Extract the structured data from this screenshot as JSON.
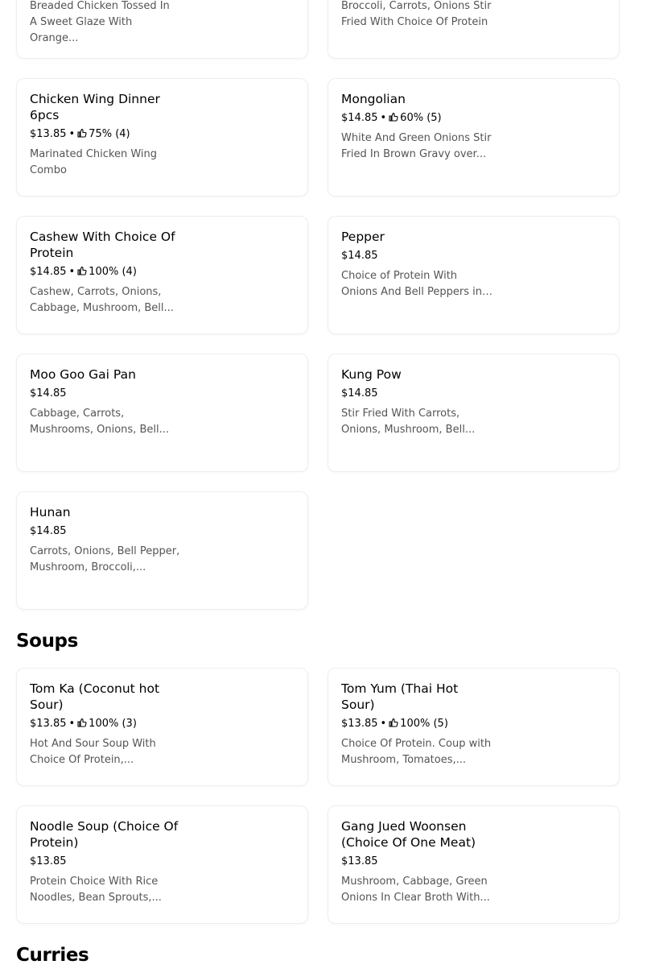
{
  "partial_cards": [
    {
      "description_lines": [
        "Breaded Chicken Tossed In",
        "A Sweet Glaze With Orange..."
      ]
    },
    {
      "description_lines": [
        "Broccoli, Carrots, Onions Stir",
        "Fried With Choice Of Protein"
      ]
    }
  ],
  "items": [
    {
      "name": "Chicken Wing Dinner 6pcs",
      "price": "$13.85",
      "rating": "75% (4)",
      "description": "Marinated Chicken Wing Combo"
    },
    {
      "name": "Mongolian",
      "price": "$14.85",
      "rating": "60% (5)",
      "description": "White And Green Onions Stir Fried In Brown Gravy over..."
    },
    {
      "name": "Cashew With Choice Of Protein",
      "price": "$14.85",
      "rating": "100% (4)",
      "description": "Cashew, Carrots, Onions, Cabbage, Mushroom, Bell..."
    },
    {
      "name": "Pepper",
      "price": "$14.85",
      "rating": null,
      "description": "Choice of Protein With Onions And Bell Peppers in ..."
    },
    {
      "name": "Moo Goo Gai Pan",
      "price": "$14.85",
      "rating": null,
      "description": "Cabbage, Carrots, Mushrooms, Onions, Bell..."
    },
    {
      "name": "Kung Pow",
      "price": "$14.85",
      "rating": null,
      "description": "Stir Fried With Carrots, Onions, Mushroom, Bell..."
    },
    {
      "name": "Hunan",
      "price": "$14.85",
      "rating": null,
      "description": "Carrots, Onions, Bell Pepper, Mushroom, Broccoli,..."
    }
  ],
  "sections": {
    "soups": {
      "title": "Soups",
      "items": [
        {
          "name": "Tom Ka (Coconut hot Sour)",
          "price": "$13.85",
          "rating": "100% (3)",
          "description": "Hot And Sour Soup With Choice Of Protein,..."
        },
        {
          "name": "Tom Yum (Thai Hot Sour)",
          "price": "$13.85",
          "rating": "100% (5)",
          "description": "Choice Of Protein. Coup with Mushroom, Tomatoes,..."
        },
        {
          "name": "Noodle Soup (Choice Of Protein)",
          "price": "$13.85",
          "rating": null,
          "description": "Protein Choice With Rice Noodles, Bean Sprouts,..."
        },
        {
          "name": "Gang Jued Woonsen (Choice Of One Meat)",
          "price": "$13.85",
          "rating": null,
          "description": "Mushroom, Cabbage, Green Onions In Clear Broth With..."
        }
      ]
    },
    "curries": {
      "title": "Curries"
    }
  },
  "separator": "•",
  "icons": {
    "rating": "thumbs-up-icon"
  }
}
